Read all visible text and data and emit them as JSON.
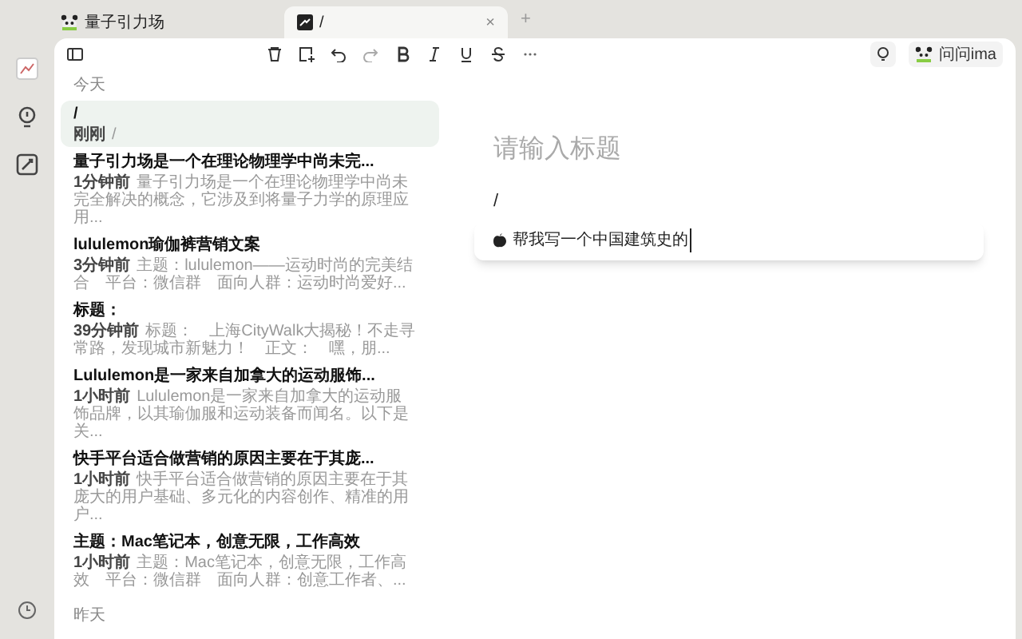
{
  "tabs": [
    {
      "label": "量子引力场",
      "selected": false
    },
    {
      "label": "/",
      "selected": true,
      "close": "×"
    }
  ],
  "new_tab": "+",
  "ask_button": "问问ima",
  "notes": {
    "groups": [
      {
        "heading": "今天",
        "items": [
          {
            "title": "/",
            "time": "刚刚",
            "preview": "/",
            "selected": true
          },
          {
            "title": "量子引力场是一个在理论物理学中尚未完...",
            "time": "1分钟前",
            "preview": "量子引力场是一个在理论物理学中尚未完全解决的概念，它涉及到将量子力学的原理应用...",
            "selected": false
          },
          {
            "title": "lululemon瑜伽裤营销文案",
            "time": "3分钟前",
            "preview": "主题：lululemon——运动时尚的完美结合　平台：微信群　面向人群：运动时尚爱好...",
            "selected": false
          },
          {
            "title": "标题：",
            "time": "39分钟前",
            "preview": "标题：　上海CityWalk大揭秘！不走寻常路，发现城市新魅力！　正文：　嘿，朋...",
            "selected": false
          },
          {
            "title": "Lululemon是一家来自加拿大的运动服饰...",
            "time": "1小时前",
            "preview": "Lululemon是一家来自加拿大的运动服饰品牌，以其瑜伽服和运动装备而闻名。以下是关...",
            "selected": false
          },
          {
            "title": "快手平台适合做营销的原因主要在于其庞...",
            "time": "1小时前",
            "preview": "快手平台适合做营销的原因主要在于其庞大的用户基础、多元化的内容创作、精准的用户...",
            "selected": false
          },
          {
            "title": "主题：Mac笔记本，创意无限，工作高效",
            "time": "1小时前",
            "preview": "主题：Mac笔记本，创意无限，工作高效　平台：微信群　面向人群：创意工作者、...",
            "selected": false
          }
        ]
      },
      {
        "heading": "昨天"
      }
    ]
  },
  "editor": {
    "title_placeholder": "请输入标题",
    "body": "/",
    "suggestion": "帮我写一个中国建筑史的"
  }
}
